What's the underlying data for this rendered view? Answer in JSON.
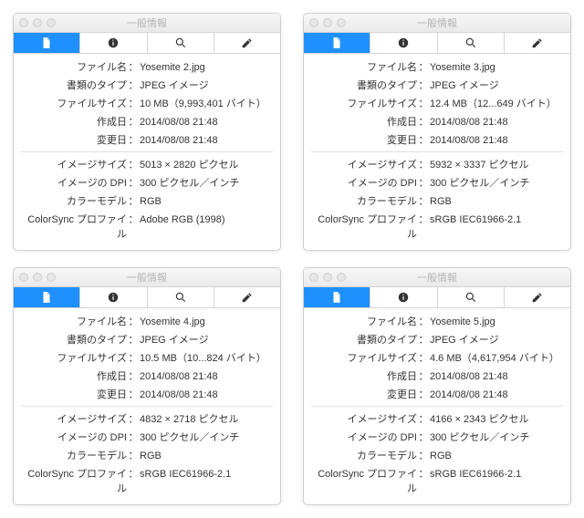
{
  "window_title": "一般情報",
  "labels": {
    "filename": "ファイル名",
    "doctype": "書類のタイプ",
    "filesize": "ファイルサイズ",
    "created": "作成日",
    "modified": "変更日",
    "imgsize": "イメージサイズ",
    "dpi": "イメージの DPI",
    "colormodel": "カラーモデル",
    "colorsync": "ColorSync プロファイル"
  },
  "windows": [
    {
      "filename": "Yosemite 2.jpg",
      "doctype": "JPEG イメージ",
      "filesize": "10 MB（9,993,401 バイト）",
      "created": "2014/08/08 21:48",
      "modified": "2014/08/08 21:48",
      "imgsize": "5013 × 2820 ピクセル",
      "dpi": "300 ピクセル／インチ",
      "colormodel": "RGB",
      "colorsync": "Adobe RGB (1998)"
    },
    {
      "filename": "Yosemite 3.jpg",
      "doctype": "JPEG イメージ",
      "filesize": "12.4 MB（12...649 バイト）",
      "created": "2014/08/08 21:48",
      "modified": "2014/08/08 21:48",
      "imgsize": "5932 × 3337 ピクセル",
      "dpi": "300 ピクセル／インチ",
      "colormodel": "RGB",
      "colorsync": "sRGB IEC61966-2.1"
    },
    {
      "filename": "Yosemite 4.jpg",
      "doctype": "JPEG イメージ",
      "filesize": "10.5 MB（10...824 バイト）",
      "created": "2014/08/08 21:48",
      "modified": "2014/08/08 21:48",
      "imgsize": "4832 × 2718 ピクセル",
      "dpi": "300 ピクセル／インチ",
      "colormodel": "RGB",
      "colorsync": "sRGB IEC61966-2.1"
    },
    {
      "filename": "Yosemite 5.jpg",
      "doctype": "JPEG イメージ",
      "filesize": "4.6 MB（4,617,954 バイト）",
      "created": "2014/08/08 21:48",
      "modified": "2014/08/08 21:48",
      "imgsize": "4166 × 2343 ピクセル",
      "dpi": "300 ピクセル／インチ",
      "colormodel": "RGB",
      "colorsync": "sRGB IEC61966-2.1"
    }
  ]
}
